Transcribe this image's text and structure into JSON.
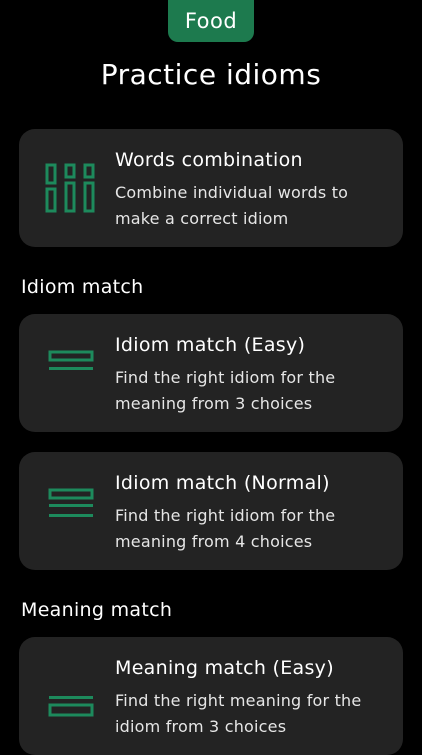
{
  "header": {
    "category_badge": "Food",
    "title": "Practice idioms"
  },
  "accent_color": "#1d8a5c",
  "cards": [
    {
      "title": "Words combination",
      "description": "Combine individual words to make a correct idiom",
      "icon": "grid-blocks-icon"
    },
    {
      "title": "Idiom match (Easy)",
      "description": "Find the right idiom for the meaning from 3 choices",
      "icon": "stacked-bars-icon"
    },
    {
      "title": "Idiom match (Normal)",
      "description": "Find the right idiom for the meaning from 4 choices",
      "icon": "stacked-bars-icon"
    },
    {
      "title": "Meaning match (Easy)",
      "description": "Find the right meaning for the idiom from 3 choices",
      "icon": "stacked-bars-icon"
    }
  ],
  "sections": {
    "idiom_match": "Idiom match",
    "meaning_match": "Meaning match"
  }
}
